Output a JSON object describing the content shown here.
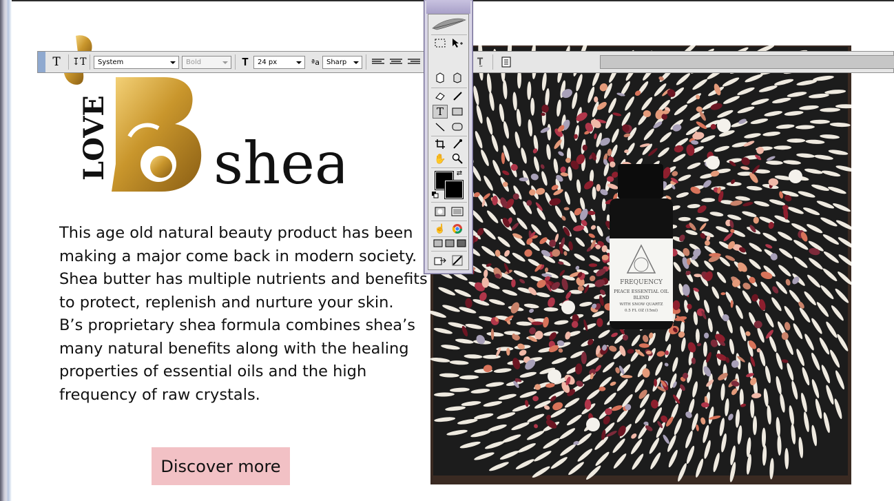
{
  "logo": {
    "love_text": "LOVE",
    "letter": "B",
    "word": "shea"
  },
  "description": {
    "lines": [
      "This age old natural beauty product  has been",
      "making a major come back in modern society.",
      "Shea butter has multiple nutrients and benefits",
      "to protect, replenish and nurture  your skin.",
      "B’s proprietary shea formula combines shea’s",
      "many natural benefits along with the healing",
      "properties of essential oils and the high",
      "frequency of raw crystals."
    ]
  },
  "cta": {
    "label": "Discover more"
  },
  "product_label": {
    "brand": "FREQUENCY",
    "line1": "PEACE ESSENTIAL OIL",
    "line2": "BLEND",
    "line3": "WITH SNOW QUARTZ",
    "line4": "0.5 FL OZ (15ml)"
  },
  "options_bar": {
    "font_family": "System",
    "font_style": "Bold",
    "font_size": "24 px",
    "antialias": "Sharp",
    "text_color": "#000000"
  },
  "colors": {
    "gold": "#c9962c",
    "button_pink": "#f2c1c5",
    "toolbox_purple": "#d9d6e6"
  },
  "toolbox": {
    "active_tool": "type-tool",
    "foreground_color": "#000000",
    "background_color": "#000000"
  }
}
